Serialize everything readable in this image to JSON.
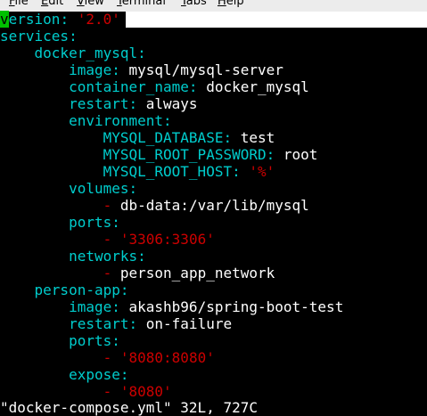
{
  "menu": [
    "File",
    "Edit",
    "View",
    "Terminal",
    "Tabs",
    "Help"
  ],
  "editor": {
    "version_key": "version",
    "version_val": "'2.0'",
    "services_key": "services",
    "docker_mysql_key": "docker_mysql",
    "image_key": "image",
    "mysql_image": "mysql/mysql-server",
    "container_name_key": "container_name",
    "container_name": "docker_mysql",
    "restart_key": "restart",
    "restart_always": "always",
    "environment_key": "environment",
    "env_db_key": "MYSQL_DATABASE",
    "env_db_val": "test",
    "env_root_pw_key": "MYSQL_ROOT_PASSWORD",
    "env_root_pw_val": "root",
    "env_root_host_key": "MYSQL_ROOT_HOST",
    "env_root_host_val": "'%'",
    "volumes_key": "volumes",
    "volume_item": "db-data:/var/lib/mysql",
    "ports_key": "ports",
    "mysql_port": "'3306:3306'",
    "networks_key": "networks",
    "network_item": "person_app_network",
    "person_app_key": "person-app",
    "app_image": "akashb96/spring-boot-test",
    "restart_failure": "on-failure",
    "app_port": "'8080:8080'",
    "expose_key": "expose",
    "expose_item": "'8080'"
  },
  "status_line": "\"docker-compose.yml\" 32L, 727C",
  "colors": {
    "background": "#000000",
    "key": "#00cdcd",
    "string": "#cd0000",
    "cursor": "#00c000"
  }
}
